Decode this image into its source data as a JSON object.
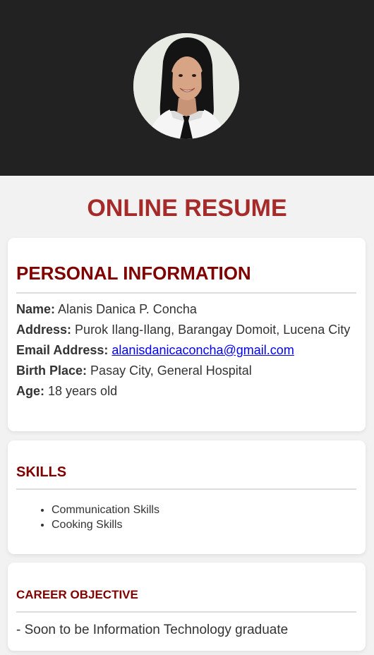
{
  "header": {
    "avatar_icon": "profile-photo-icon",
    "background": "#222222"
  },
  "page_title": "ONLINE RESUME",
  "personal": {
    "heading": "PERSONAL INFORMATION",
    "name_label": "Name:",
    "name_value": "Alanis Danica P. Concha",
    "address_label": "Address:",
    "address_value": "Purok Ilang-Ilang, Barangay Domoit, Lucena City",
    "email_label": "Email Address:",
    "email_value": "alanisdanicaconcha@gmail.com",
    "birth_label": "Birth Place:",
    "birth_value": "Pasay City, General Hospital",
    "age_label": "Age:",
    "age_value": "18 years old"
  },
  "skills": {
    "heading": "SKILLS",
    "items": [
      "Communication Skills",
      "Cooking Skills"
    ]
  },
  "career": {
    "heading": "CAREER OBJECTIVE",
    "text": "- Soon to be Information Technology graduate"
  },
  "colors": {
    "title": "#a52a2a",
    "heading": "#800000",
    "link": "#0000ee"
  }
}
